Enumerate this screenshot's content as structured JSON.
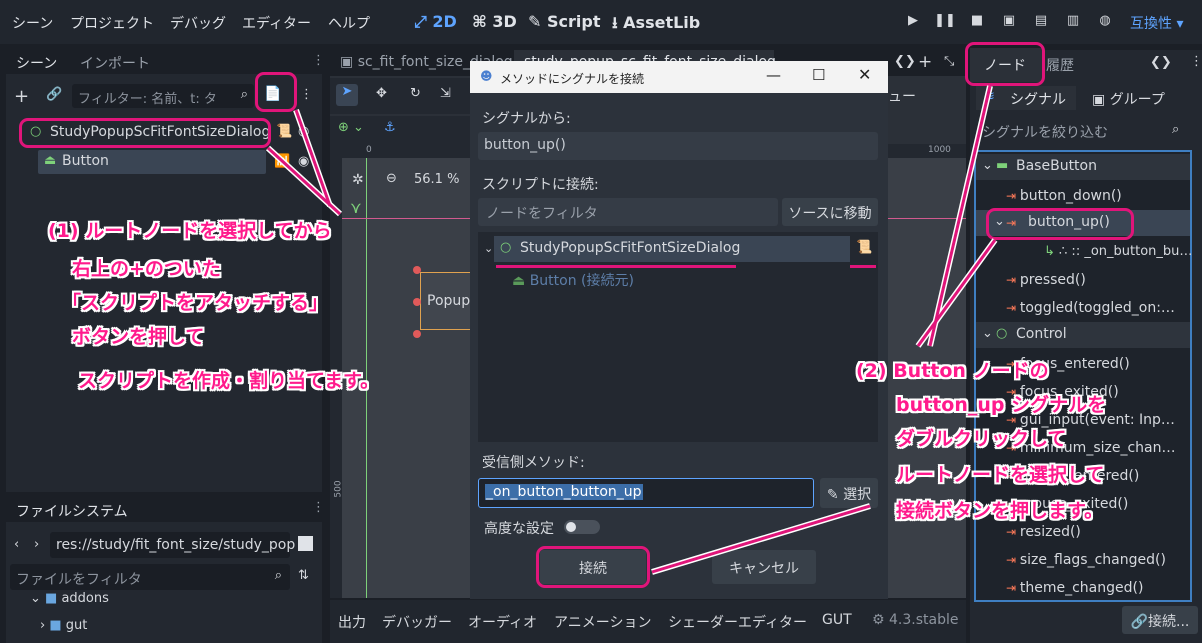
{
  "menu": [
    "シーン",
    "プロジェクト",
    "デバッグ",
    "エディター",
    "ヘルプ"
  ],
  "modes": {
    "2d": "2D",
    "3d": "3D",
    "script": "Script",
    "assetlib": "AssetLib"
  },
  "compat": "互換性",
  "left_tabs": {
    "scene": "シーン",
    "import": "インポート"
  },
  "scene_filter": "フィルター: 名前、t: タ",
  "tree": {
    "root": "StudyPopupScFitFontSizeDialog",
    "child": "Button"
  },
  "fs": {
    "title": "ファイルシステム",
    "path": "res://study/fit_font_size/study_pop",
    "filter": "ファイルをフィルタ",
    "addons": "addons",
    "gut": "gut"
  },
  "editor_tabs": [
    "sc_fit_font_size_dialog",
    "study_popup_sc_fit_font_size_dialog"
  ],
  "zoom": "56.1 %",
  "ruler": {
    "zero": "0",
    "thousand": "1000",
    "five_hundred": "500"
  },
  "popup_text": "Popup",
  "uyu": "ュー",
  "dialog": {
    "title": "メソッドにシグナルを接続",
    "from_label": "シグナルから:",
    "from_value": "button_up()",
    "script_label": "スクリプトに接続:",
    "node_filter": "ノードをフィルタ",
    "goto_source": "ソースに移動",
    "tree_root": "StudyPopupScFitFontSizeDialog",
    "tree_child": "Button (接続元)",
    "receiver_label": "受信側メソッド:",
    "receiver_value": "_on_button_button_up",
    "pick": "選択",
    "advanced": "高度な設定",
    "connect": "接続",
    "cancel": "キャンセル"
  },
  "right": {
    "tab_node": "ノード",
    "tab_history": "履歴",
    "sub_signal": "シグナル",
    "sub_group": "グループ",
    "filter": "シグナルを絞り込む",
    "section1": "BaseButton",
    "signals1": [
      "button_down()",
      "button_up()",
      "∴ :: _on_button_bu…",
      "pressed()",
      "toggled(toggled_on:…"
    ],
    "section2": "Control",
    "signals2": [
      "focus_entered()",
      "focus_exited()",
      "gui_input(event: Inp…",
      "minimum_size_chan…",
      "mouse_entered()",
      "mouse_exited()",
      "resized()",
      "size_flags_changed()",
      "theme_changed()"
    ],
    "connect_btn": "接続..."
  },
  "bottom": [
    "出力",
    "デバッガー",
    "オーディオ",
    "アニメーション",
    "シェーダーエディター",
    "GUT"
  ],
  "version": "4.3.stable",
  "annotation1": [
    "(1) ルートノードを選択してから",
    "右上の+のついた",
    "「スクリプトをアタッチする」",
    "ボタンを押して",
    "スクリプトを作成・割り当てます。"
  ],
  "annotation2": [
    "(2) Button ノードの",
    "button_up シグナルを",
    "ダブルクリックして",
    "ルートノードを選択して",
    "接続ボタンを押します。"
  ],
  "colors": {
    "accent": "#5ea4ff",
    "annotation": "#ff1a8c",
    "bg": "#1b1f26",
    "panel": "#232830"
  }
}
